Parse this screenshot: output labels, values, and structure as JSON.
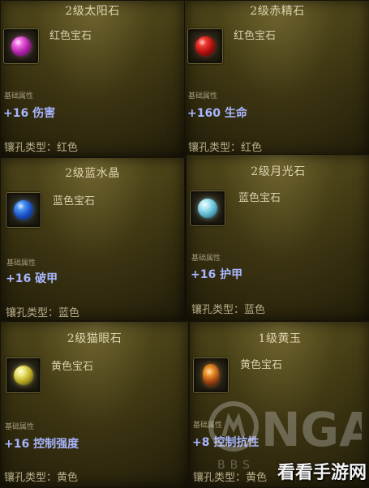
{
  "cards": [
    {
      "title": "2级太阳石",
      "subtitle": "红色宝石",
      "attr_label": "基础属性",
      "stat": "+16 伤害",
      "socket": "镶孔类型：红色",
      "gem_icon": "purple-gem-icon",
      "gem_color": "#d040c8"
    },
    {
      "title": "2级赤精石",
      "subtitle": "红色宝石",
      "attr_label": "基础属性",
      "stat": "+160 生命",
      "socket": "镶孔类型：红色",
      "gem_icon": "red-gem-icon",
      "gem_color": "#c8161a"
    },
    {
      "title": "2级蓝水晶",
      "subtitle": "蓝色宝石",
      "attr_label": "基础属性",
      "stat": "+16 破甲",
      "socket": "镶孔类型：蓝色",
      "gem_icon": "blue-gem-icon",
      "gem_color": "#2c6cd8"
    },
    {
      "title": "2级月光石",
      "subtitle": "蓝色宝石",
      "attr_label": "基础属性",
      "stat": "+16 护甲",
      "socket": "镶孔类型：蓝色",
      "gem_icon": "light-blue-gem-icon",
      "gem_color": "#8ad4e8"
    },
    {
      "title": "2级猫眼石",
      "subtitle": "黄色宝石",
      "attr_label": "基础属性",
      "stat": "+16 控制强度",
      "socket": "镶孔类型：黄色",
      "gem_icon": "yellow-gem-icon",
      "gem_color": "#e0d84a"
    },
    {
      "title": "1级黄玉",
      "subtitle": "黄色宝石",
      "attr_label": "基础属性",
      "stat": "+8 控制抗性",
      "socket": "镶孔类型：黄色",
      "gem_icon": "orange-gem-icon",
      "gem_color": "#d8761c"
    }
  ],
  "watermark": {
    "logo_text": "NGA",
    "bbs_text": "BBS"
  },
  "site_mark": "看看手游网"
}
